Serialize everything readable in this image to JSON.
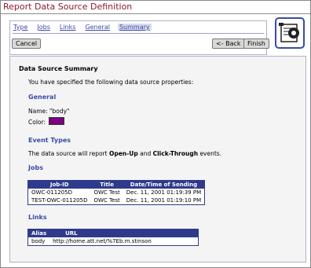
{
  "page": {
    "title": "Report Data Source Definition"
  },
  "nav": {
    "tabs": [
      "Type",
      "Jobs",
      "Links",
      "General",
      "Summary"
    ],
    "selected_tab": "Summary",
    "cancel_label": "Cancel",
    "back_label": "<- Back",
    "finish_label": "Finish"
  },
  "summary": {
    "heading": "Data Source Summary",
    "intro": "You have specified the following data source properties:",
    "general": {
      "heading": "General",
      "name_line": "Name: \"body\"",
      "color_label": "Color:",
      "color_value": "#800080"
    },
    "event_types": {
      "heading": "Event Types",
      "text_pre": "The data source will report ",
      "event1": "Open-Up",
      "and": " and ",
      "event2": "Click-Through",
      "text_post": " events."
    },
    "jobs": {
      "heading": "Jobs",
      "columns": [
        "Job-ID",
        "Title",
        "Date/Time of Sending"
      ],
      "rows": [
        [
          "OWC-011205D",
          "OWC Test",
          "Dec. 11, 2001 01:19:39 PM"
        ],
        [
          "TEST-OWC-011205D",
          "OWC Test",
          "Dec. 11, 2001 01:19:10 PM"
        ]
      ]
    },
    "links": {
      "heading": "Links",
      "columns": [
        "Alias",
        "URL"
      ],
      "rows": [
        [
          "body",
          "http://home.att.net/%7Eb.m.stinson"
        ]
      ]
    }
  },
  "icons": {
    "help": "form-help-icon"
  }
}
